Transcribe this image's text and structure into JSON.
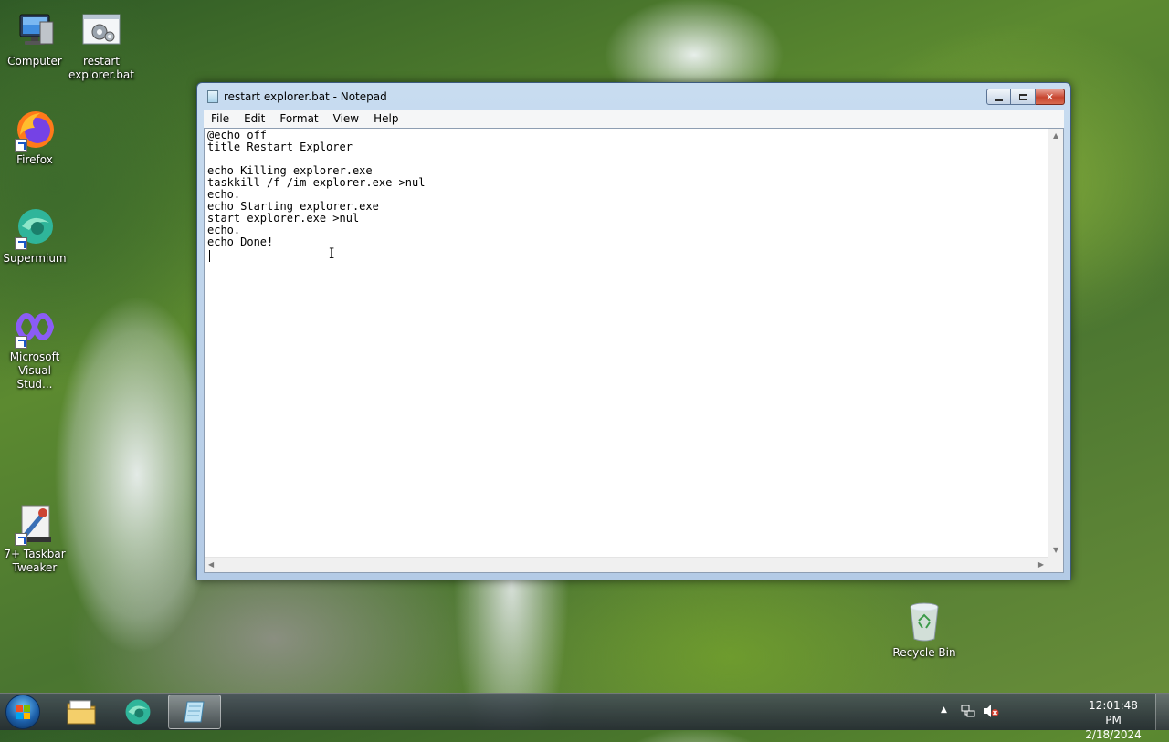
{
  "desktop": {
    "icons": [
      {
        "label_1": "Computer",
        "label_2": ""
      },
      {
        "label_1": "restart",
        "label_2": "explorer.bat"
      },
      {
        "label_1": "Firefox",
        "label_2": ""
      },
      {
        "label_1": "Supermium",
        "label_2": ""
      },
      {
        "label_1": "Microsoft",
        "label_2": "Visual Stud..."
      },
      {
        "label_1": "7+ Taskbar",
        "label_2": "Tweaker"
      },
      {
        "label_1": "Recycle Bin",
        "label_2": ""
      }
    ]
  },
  "window": {
    "title": "restart explorer.bat - Notepad",
    "menu": [
      "File",
      "Edit",
      "Format",
      "View",
      "Help"
    ],
    "content": "@echo off\ntitle Restart Explorer\n\necho Killing explorer.exe\ntaskkill /f /im explorer.exe >nul\necho.\necho Starting explorer.exe\nstart explorer.exe >nul\necho.\necho Done!"
  },
  "taskbar": {
    "pinned": [
      "file-explorer-icon",
      "supermium-icon",
      "notepad-icon"
    ],
    "clock_time": "12:01:48 PM",
    "clock_date": "2/18/2024"
  },
  "colors": {
    "title_bar": "#c8dcf0",
    "close_button": "#c7452f",
    "taskbar": "#2f3842"
  }
}
